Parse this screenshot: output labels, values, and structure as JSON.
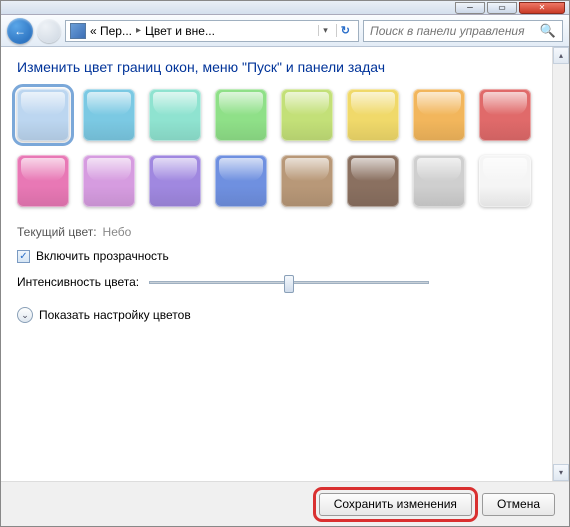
{
  "titlebar": {
    "min_icon": "─",
    "max_icon": "▭",
    "close_icon": "✕"
  },
  "toolbar": {
    "back_icon": "←",
    "breadcrumb_sep": "▸",
    "breadcrumb1": "« Пер...",
    "breadcrumb2": "Цвет и вне...",
    "dropdown_icon": "▾",
    "refresh_icon": "↻",
    "search_placeholder": "Поиск в панели управления",
    "search_icon": "🔍"
  },
  "heading": "Изменить цвет границ окон, меню \"Пуск\" и панели задач",
  "swatches": [
    {
      "color": "#bcd6f0",
      "selected": true
    },
    {
      "color": "#7bc9e3"
    },
    {
      "color": "#8fe3d0"
    },
    {
      "color": "#8fe088"
    },
    {
      "color": "#c3e078"
    },
    {
      "color": "#f0d96a"
    },
    {
      "color": "#f2b65c"
    },
    {
      "color": "#e06a6a"
    },
    {
      "color": "#e878b5"
    },
    {
      "color": "#d69ce0"
    },
    {
      "color": "#a088e0"
    },
    {
      "color": "#6f90e0"
    },
    {
      "color": "#b89878"
    },
    {
      "color": "#8a7060"
    },
    {
      "color": "#cfcfcf"
    },
    {
      "color": "#f5f5f5"
    }
  ],
  "current_color_label": "Текущий цвет:",
  "current_color_value": "Небо",
  "transparency_label": "Включить прозрачность",
  "transparency_checked": true,
  "intensity_label": "Интенсивность цвета:",
  "intensity_value": 50,
  "expand_label": "Показать настройку цветов",
  "expand_icon": "⌄",
  "buttons": {
    "save": "Сохранить изменения",
    "cancel": "Отмена"
  },
  "scroll_up": "▴",
  "scroll_down": "▾"
}
